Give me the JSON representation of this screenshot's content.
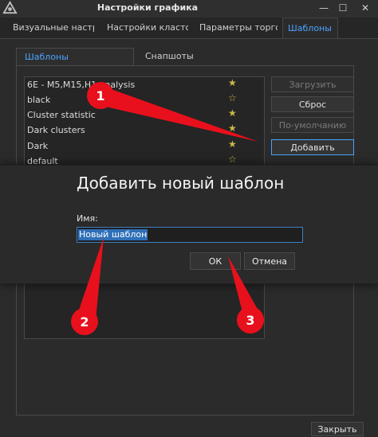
{
  "window": {
    "title": "Настройки графика",
    "minimize_glyph": "—",
    "restore_glyph": "☐",
    "close_glyph": "✕"
  },
  "top_tabs": [
    {
      "label": "Визуальные настр"
    },
    {
      "label": "Настройки класто"
    },
    {
      "label": "Параметры торго"
    },
    {
      "label": "Шаблоны"
    }
  ],
  "sub_tabs": [
    {
      "label": "Шаблоны"
    },
    {
      "label": "Снапшоты"
    }
  ],
  "templates": [
    {
      "name": "6E - M5,M15,H1 analysis"
    },
    {
      "name": "black"
    },
    {
      "name": "Cluster statistic"
    },
    {
      "name": "Dark clusters"
    },
    {
      "name": "Dark"
    },
    {
      "name": "default"
    }
  ],
  "star_glyph": "★",
  "star_outline_glyph": "☆",
  "side_buttons": {
    "load": "Загрузить",
    "reset": "Сброс",
    "default": "По-умолчанию",
    "add": "Добавить"
  },
  "dialog": {
    "title": "Добавить новый шаблон",
    "name_label": "Имя:",
    "name_value": "Новый шаблон",
    "ok": "ОК",
    "cancel": "Отмена"
  },
  "footer": {
    "close": "Закрыть"
  },
  "markers": [
    {
      "label": "1"
    },
    {
      "label": "2"
    },
    {
      "label": "3"
    }
  ],
  "colors": {
    "accent": "#4aa3ff",
    "marker_red": "#e8101c",
    "star": "#c8b94a"
  }
}
